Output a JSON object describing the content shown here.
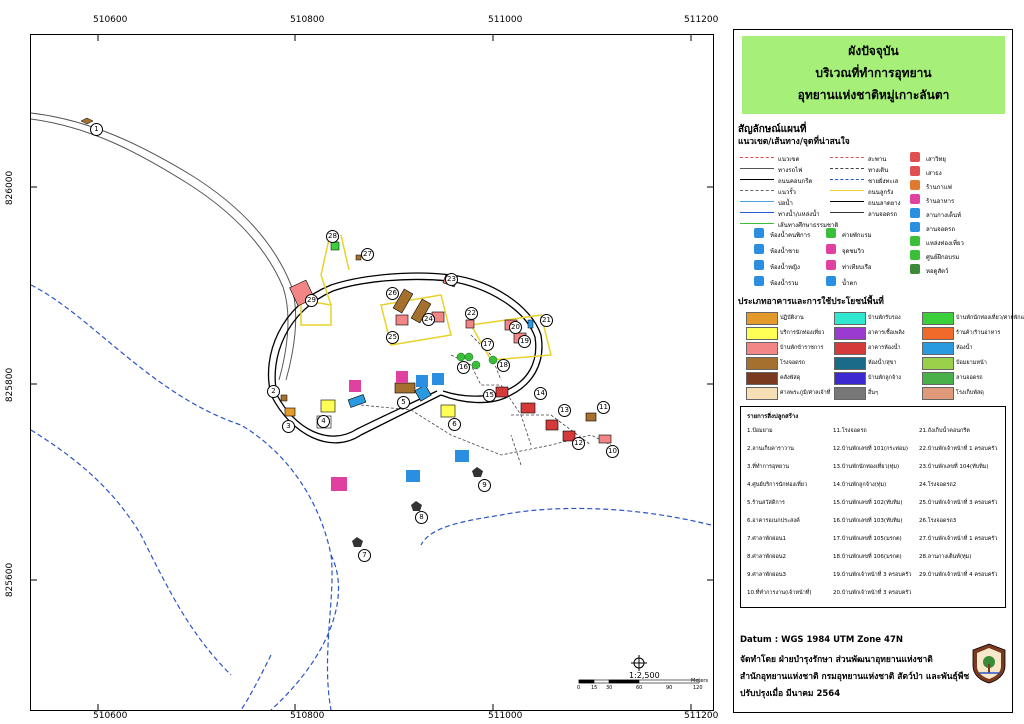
{
  "map": {
    "x_ticks": [
      "510600",
      "510800",
      "511000",
      "511200"
    ],
    "y_ticks": [
      "826000",
      "825800",
      "825600"
    ],
    "scale_text": "1:2,500",
    "scale_ticks": [
      "0",
      "15",
      "30",
      "60",
      "90",
      "120"
    ],
    "scale_unit": "Meters",
    "point_numbers": [
      "1",
      "2",
      "3",
      "4",
      "5",
      "6",
      "7",
      "8",
      "9",
      "10",
      "11",
      "12",
      "13",
      "14",
      "15",
      "16",
      "17",
      "18",
      "19",
      "20",
      "21",
      "22",
      "23",
      "24",
      "25",
      "26",
      "27",
      "28",
      "29"
    ]
  },
  "title": {
    "line1": "ผังปัจจุบัน",
    "line2": "บริเวณที่ทำการอุทยาน",
    "line3": "อุทยานแห่งชาติหมู่เกาะลันตา"
  },
  "legend": {
    "heading": "สัญลักษณ์แผนที่",
    "subheading": "แนวเขต/เส้นทาง/จุดที่น่าสนใจ",
    "lines": [
      {
        "label": "แนวเขต",
        "color": "#e24a4a",
        "style": "dashed"
      },
      {
        "label": "ทางรถไฟ",
        "color": "#555555",
        "style": "solid"
      },
      {
        "label": "ถนนคอนกรีต",
        "color": "#000000",
        "style": "solid"
      },
      {
        "label": "แนวรั้ว",
        "color": "#666666",
        "style": "dashed"
      },
      {
        "label": "บ่อน้ำ",
        "color": "#4aa0e0",
        "style": "solid"
      },
      {
        "label": "ทางน้ำ/แหล่งน้ำ",
        "color": "#1f5fd0",
        "style": "solid"
      },
      {
        "label": "เส้นทางศึกษาธรรมชาติ",
        "color": "#3bbf3b",
        "style": "solid"
      }
    ],
    "lines2": [
      {
        "label": "สะพาน",
        "color": "#d06060",
        "style": "dashed"
      },
      {
        "label": "ทางเดิน",
        "color": "#444444",
        "style": "dashed"
      },
      {
        "label": "ชายฝั่งทะเล",
        "color": "#2255cc",
        "style": "dashed"
      },
      {
        "label": "ถนนลูกรัง",
        "color": "#e8d22a",
        "style": "solid"
      },
      {
        "label": "ถนนลาดยาง",
        "color": "#000000",
        "style": "solid"
      },
      {
        "label": "ลานจอดรถ",
        "color": "#333333",
        "style": "solid"
      }
    ],
    "points_right": [
      {
        "label": "เสาวิทยุ",
        "color": "#e05050"
      },
      {
        "label": "เสาธง",
        "color": "#e05050"
      },
      {
        "label": "ร้านกาแฟ",
        "color": "#e07a30"
      },
      {
        "label": "ร้านอาหาร",
        "color": "#e040a0"
      },
      {
        "label": "ลานกางเต็นท์",
        "color": "#2a8fe0"
      },
      {
        "label": "ลานจอดรถ",
        "color": "#2a8fe0"
      },
      {
        "label": "แหล่งท่องเที่ยว",
        "color": "#3bbf3b"
      },
      {
        "label": "ศูนย์ฝึกอบรม",
        "color": "#3bbf3b"
      },
      {
        "label": "หอดูสัตว์",
        "color": "#3a8a3a"
      }
    ],
    "points_left": [
      {
        "label": "ห้องน้ำคนพิการ",
        "color": "#2a8fe0"
      },
      {
        "label": "ห้องน้ำชาย",
        "color": "#2a8fe0"
      },
      {
        "label": "ห้องน้ำหญิง",
        "color": "#2a8fe0"
      },
      {
        "label": "ห้องน้ำรวม",
        "color": "#2a8fe0"
      }
    ],
    "points_mid": [
      {
        "label": "ค่ายพักแรม",
        "color": "#3bbf3b"
      },
      {
        "label": "จุดชมวิว",
        "color": "#e040a0"
      },
      {
        "label": "ท่าเทียบเรือ",
        "color": "#e040a0"
      },
      {
        "label": "น้ำตก",
        "color": "#2a8fe0"
      }
    ],
    "usage_heading": "ประเภทอาคารและการใช้ประโยชน์พื้นที่",
    "usage": [
      {
        "label": "ปฏิบัติงาน",
        "color": "#e39a2a"
      },
      {
        "label": "บริการนักท่องเที่ยว",
        "color": "#ffff55"
      },
      {
        "label": "บ้านพักข้าราชการ",
        "color": "#f28585"
      },
      {
        "label": "โรงจอดรถ",
        "color": "#a5702e"
      },
      {
        "label": "คลังพัสดุ",
        "color": "#7a3a20"
      },
      {
        "label": "ศาลพระภูมิ/ศาลเจ้าที่",
        "color": "#f6dfb4"
      },
      {
        "label": "บ้านพักรับรอง",
        "color": "#30e8d0"
      },
      {
        "label": "อาคารเชื้อเพลิง",
        "color": "#9a3acf"
      },
      {
        "label": "อาคารห้องน้ำ",
        "color": "#d43a3a"
      },
      {
        "label": "ห้องน้ำ/สุขา",
        "color": "#1a6a8a"
      },
      {
        "label": "บ้านพักลูกจ้าง",
        "color": "#3a2acf"
      },
      {
        "label": "อื่นๆ",
        "color": "#777777"
      },
      {
        "label": "บ้านพักนักท่องเที่ยว/ค่ายพักแรม",
        "color": "#3bcf3b"
      },
      {
        "label": "ร้านค้า/ร้านอาหาร",
        "color": "#f26a2a"
      },
      {
        "label": "ห้องน้ำ",
        "color": "#2a9ae0"
      },
      {
        "label": "ป้อมยามหน้า",
        "color": "#9ad04a"
      },
      {
        "label": "ลานจอดรถ",
        "color": "#4ab04a"
      },
      {
        "label": "โรงเก็บพัสดุ",
        "color": "#e09a7a"
      }
    ],
    "table_heading": "รายการสิ่งปลูกสร้าง",
    "table_col1": [
      "1.ป้อมยาม",
      "2.ลานเก็บคาราวาน",
      "3.ที่ทำการอุทยาน",
      "4.ศูนย์บริการนักท่องเที่ยว",
      "5.ร้านสวัสดิการ",
      "6.อาคารอเนกประสงค์",
      "7.ศาลาพักผ่อน1",
      "8.ศาลาพักผ่อน2",
      "9.ศาลาพักผ่อน3",
      "10.ที่ทำการงาน(เจ้าหน้าที่)"
    ],
    "table_col2": [
      "11.โรงจอดรถ",
      "12.บ้านพักเลขที่ 101(กระท่อม)",
      "13.บ้านพักนักท่องเที่ยว(ทุ่ม)",
      "14.บ้านพักลูกจ้าง(ทุ่ม)",
      "15.บ้านพักเลขที่ 102(ทับทิม)",
      "16.บ้านพักเลขที่ 103(ทับทิม)",
      "17.บ้านพักเลขที่ 105(มรกต)",
      "18.บ้านพักเลขที่ 106(มรกต)",
      "19.บ้านพักเจ้าหน้าที่ 3 ครอบครัว",
      "20.บ้านพักเจ้าหน้าที่ 3 ครอบครัว"
    ],
    "table_col3": [
      "21.ถังเก็บน้ำคอนกรีต",
      "22.บ้านพักเจ้าหน้าที่ 1 ครอบครัว",
      "23.บ้านพักเลขที่ 104(ทับทิม)",
      "24.โรงจอดรถ2",
      "25.บ้านพักเจ้าหน้าที่ 3 ครอบครัว",
      "26.โรงจอดรถ3",
      "27.บ้านพักเจ้าหน้าที่ 1 ครอบครัว",
      "28.ลานกางเต็นท์(ทุ่ม)",
      "29.บ้านพักเจ้าหน้าที่ 4 ครอบครัว"
    ]
  },
  "footer": {
    "datum": "Datum  : WGS 1984 UTM Zone 47N",
    "made_by": "จัดทำโดย  ฝ่ายบำรุงรักษา ส่วนพัฒนาอุทยานแห่งชาติ",
    "office": "สำนักอุทยานแห่งชาติ  กรมอุทยานแห่งชาติ สัตว์ป่า และพันธุ์พืช",
    "updated": "ปรับปรุงเมื่อ มีนาคม 2564"
  }
}
